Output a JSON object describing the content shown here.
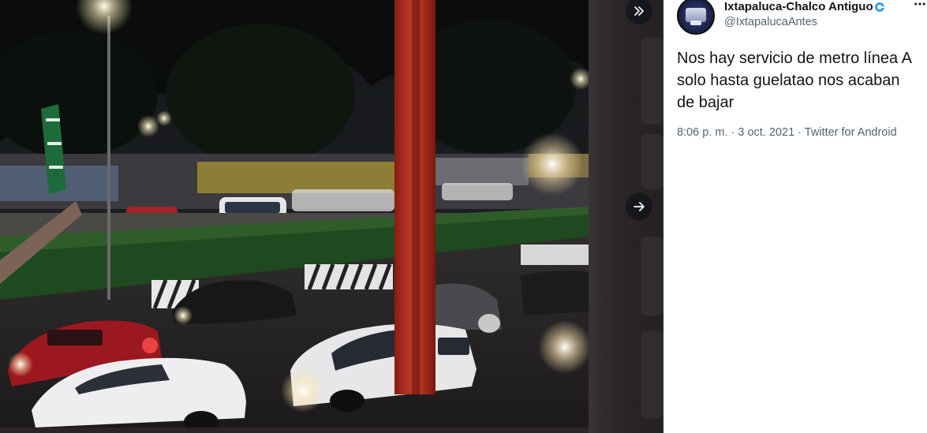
{
  "media": {
    "photo_alt": "",
    "controls": {
      "collapse_icon": "double-chevron-right-icon",
      "next_icon": "arrow-right-icon"
    }
  },
  "tweet": {
    "author": {
      "display_name": "Ixtapaluca-Chalco Antiguo",
      "handle": "@IxtapalucaAntes",
      "verified_icon": "verified-badge-icon"
    },
    "text": "Nos hay servicio de metro línea A solo hasta guelatao nos acaban de bajar",
    "time": "8:06 p. m.",
    "separator": "·",
    "date": "3 oct. 2021",
    "source": "Twitter for Android",
    "more_icon": "more-dots-icon"
  },
  "colors": {
    "overlay": "#2a2425",
    "panel": "#ffffff",
    "text_primary": "#0f1419",
    "text_secondary": "#536471",
    "accent": "#1d9bf0"
  }
}
